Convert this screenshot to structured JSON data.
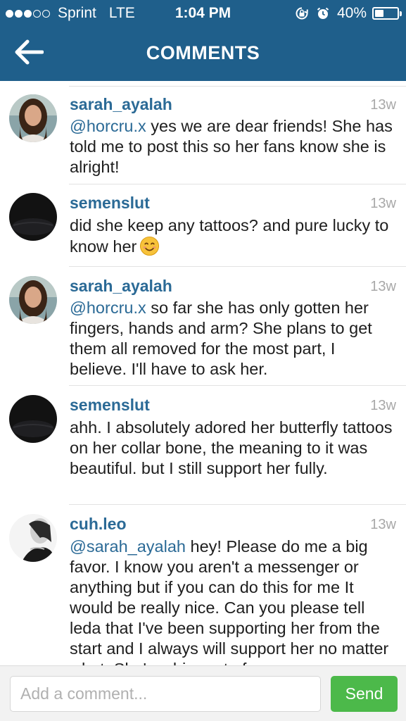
{
  "status_bar": {
    "signal_bars_filled": 3,
    "signal_bars_total": 5,
    "carrier": "Sprint",
    "network": "LTE",
    "time": "1:04 PM",
    "icons": [
      "rotation-lock-icon",
      "alarm-icon"
    ],
    "battery_percent": "40%",
    "battery_level": 0.4
  },
  "nav": {
    "back_icon": "back-arrow-icon",
    "title": "COMMENTS"
  },
  "comments": [
    {
      "username": "sarah_ayalah",
      "time": "13w",
      "mention": "@horcru.x",
      "text": " yes we are dear friends! She has told me to post this so her fans know she is alright!",
      "avatar": "photo-woman"
    },
    {
      "username": "semenslut",
      "time": "13w",
      "mention": "",
      "text": "did she keep any tattoos? and pure lucky to know her",
      "emoji": "smiling-face-emoji",
      "avatar": "dark"
    },
    {
      "username": "sarah_ayalah",
      "time": "13w",
      "mention": "@horcru.x",
      "text": " so far she has only gotten her fingers, hands and arm? She plans to get them all removed for the most part, I believe. I'll have to ask her.",
      "avatar": "photo-woman"
    },
    {
      "username": "semenslut",
      "time": "13w",
      "mention": "",
      "text": "ahh. I absolutely adored her butterfly tattoos on her collar bone, the meaning to it was beautiful. but I still support her fully.",
      "avatar": "dark"
    },
    {
      "username": "cuh.leo",
      "time": "13w",
      "mention": "@sarah_ayalah",
      "text": " hey! Please do me a big favor. I know you aren't a messenger or anything but if you can do this for me It would be really nice. Can you please tell leda that I've been supporting her from the start and I always will support her no matter what. She's a big part of",
      "avatar": "photo-bw"
    }
  ],
  "composer": {
    "placeholder": "Add a comment...",
    "send_label": "Send"
  },
  "colors": {
    "header": "#1f5f8b",
    "username": "#2b6a96",
    "send": "#4cb94a"
  }
}
